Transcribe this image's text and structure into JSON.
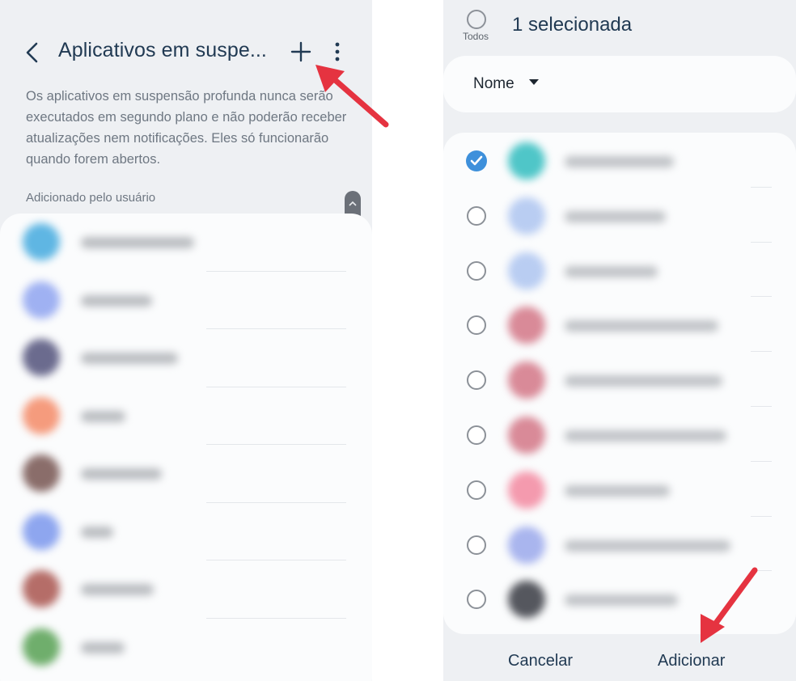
{
  "left_screen": {
    "title": "Aplicativos em suspe...",
    "description": "Os aplicativos em suspensão profunda nunca serão executados em segundo plano e não poderão receber atualizações nem notificações. Eles só funcionarão quando forem abertos.",
    "section_header": "Adicionado pelo usuário",
    "apps": [
      {
        "icon_color": "#5fb6e3",
        "label_width": 140
      },
      {
        "icon_color": "#9fb1f2",
        "label_width": 88
      },
      {
        "icon_color": "#6b6b8e",
        "label_width": 120
      },
      {
        "icon_color": "#f59b7d",
        "label_width": 55
      },
      {
        "icon_color": "#8a6d6a",
        "label_width": 100
      },
      {
        "icon_color": "#8ea6ef",
        "label_width": 40
      },
      {
        "icon_color": "#b56d68",
        "label_width": 90
      },
      {
        "icon_color": "#6fae6c",
        "label_width": 54
      }
    ]
  },
  "right_screen": {
    "select_all_label": "Todos",
    "selection_count_text": "1 selecionada",
    "sort_label": "Nome",
    "apps": [
      {
        "icon_color": "#4fc6c8",
        "label_width": 135,
        "selected": true
      },
      {
        "icon_color": "#b9cdf2",
        "label_width": 125,
        "selected": false
      },
      {
        "icon_color": "#b9cdf2",
        "label_width": 115,
        "selected": false
      },
      {
        "icon_color": "#d98a98",
        "label_width": 190,
        "selected": false
      },
      {
        "icon_color": "#d98a98",
        "label_width": 195,
        "selected": false
      },
      {
        "icon_color": "#d98a98",
        "label_width": 200,
        "selected": false
      },
      {
        "icon_color": "#f49aae",
        "label_width": 130,
        "selected": false
      },
      {
        "icon_color": "#a9b5ee",
        "label_width": 205,
        "selected": false
      },
      {
        "icon_color": "#55575e",
        "label_width": 140,
        "selected": false
      }
    ],
    "cancel_label": "Cancelar",
    "add_label": "Adicionar"
  },
  "colors": {
    "arrow_red": "#e53340",
    "checkbox_blue": "#3e90db",
    "title_text": "#213a53"
  }
}
